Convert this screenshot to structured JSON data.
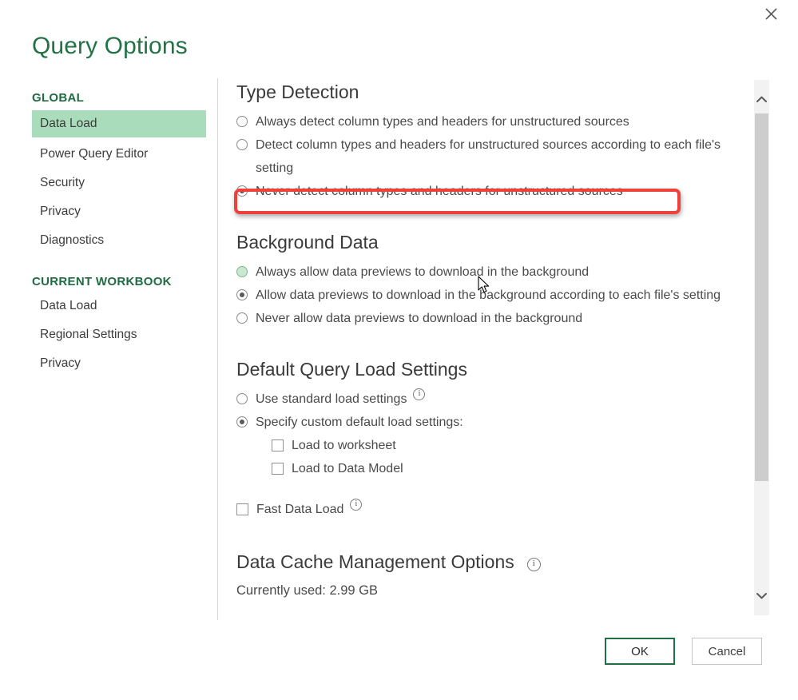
{
  "window": {
    "title": "Query Options",
    "close_label": "✕"
  },
  "sidebar": {
    "groups": [
      {
        "title": "GLOBAL",
        "items": [
          {
            "label": "Data Load",
            "selected": true
          },
          {
            "label": "Power Query Editor",
            "selected": false
          },
          {
            "label": "Security",
            "selected": false
          },
          {
            "label": "Privacy",
            "selected": false
          },
          {
            "label": "Diagnostics",
            "selected": false
          }
        ]
      },
      {
        "title": "CURRENT WORKBOOK",
        "items": [
          {
            "label": "Data Load",
            "selected": false
          },
          {
            "label": "Regional Settings",
            "selected": false
          },
          {
            "label": "Privacy",
            "selected": false
          }
        ]
      }
    ]
  },
  "content": {
    "type_detection": {
      "heading": "Type Detection",
      "options": [
        {
          "label": "Always detect column types and headers for unstructured sources",
          "selected": false
        },
        {
          "label": "Detect column types and headers for unstructured sources according to each file's setting",
          "selected": false
        },
        {
          "label": "Never detect column types and headers for unstructured sources",
          "selected": true,
          "highlighted": true
        }
      ]
    },
    "background_data": {
      "heading": "Background Data",
      "options": [
        {
          "label": "Always allow data previews to download in the background",
          "selected": false,
          "hovered": true
        },
        {
          "label": "Allow data previews to download in the background according to each file's setting",
          "selected": true
        },
        {
          "label": "Never allow data previews to download in the background",
          "selected": false
        }
      ]
    },
    "default_query_load": {
      "heading": "Default Query Load Settings",
      "options": [
        {
          "label": "Use standard load settings",
          "selected": false,
          "info": true
        },
        {
          "label": "Specify custom default load settings:",
          "selected": true
        }
      ],
      "checkboxes": [
        {
          "label": "Load to worksheet",
          "checked": false
        },
        {
          "label": "Load to Data Model",
          "checked": false
        }
      ],
      "fast_data_load": {
        "label": "Fast Data Load",
        "checked": false,
        "info": true
      }
    },
    "data_cache": {
      "heading": "Data Cache Management Options",
      "info": true,
      "currently_used": "Currently used: 2.99 GB"
    }
  },
  "footer": {
    "ok_label": "OK",
    "cancel_label": "Cancel"
  },
  "colors": {
    "accent_green": "#217346",
    "selection_green": "#a9dcba",
    "highlight_red": "#f0403a",
    "text": "#4a4a4a"
  }
}
